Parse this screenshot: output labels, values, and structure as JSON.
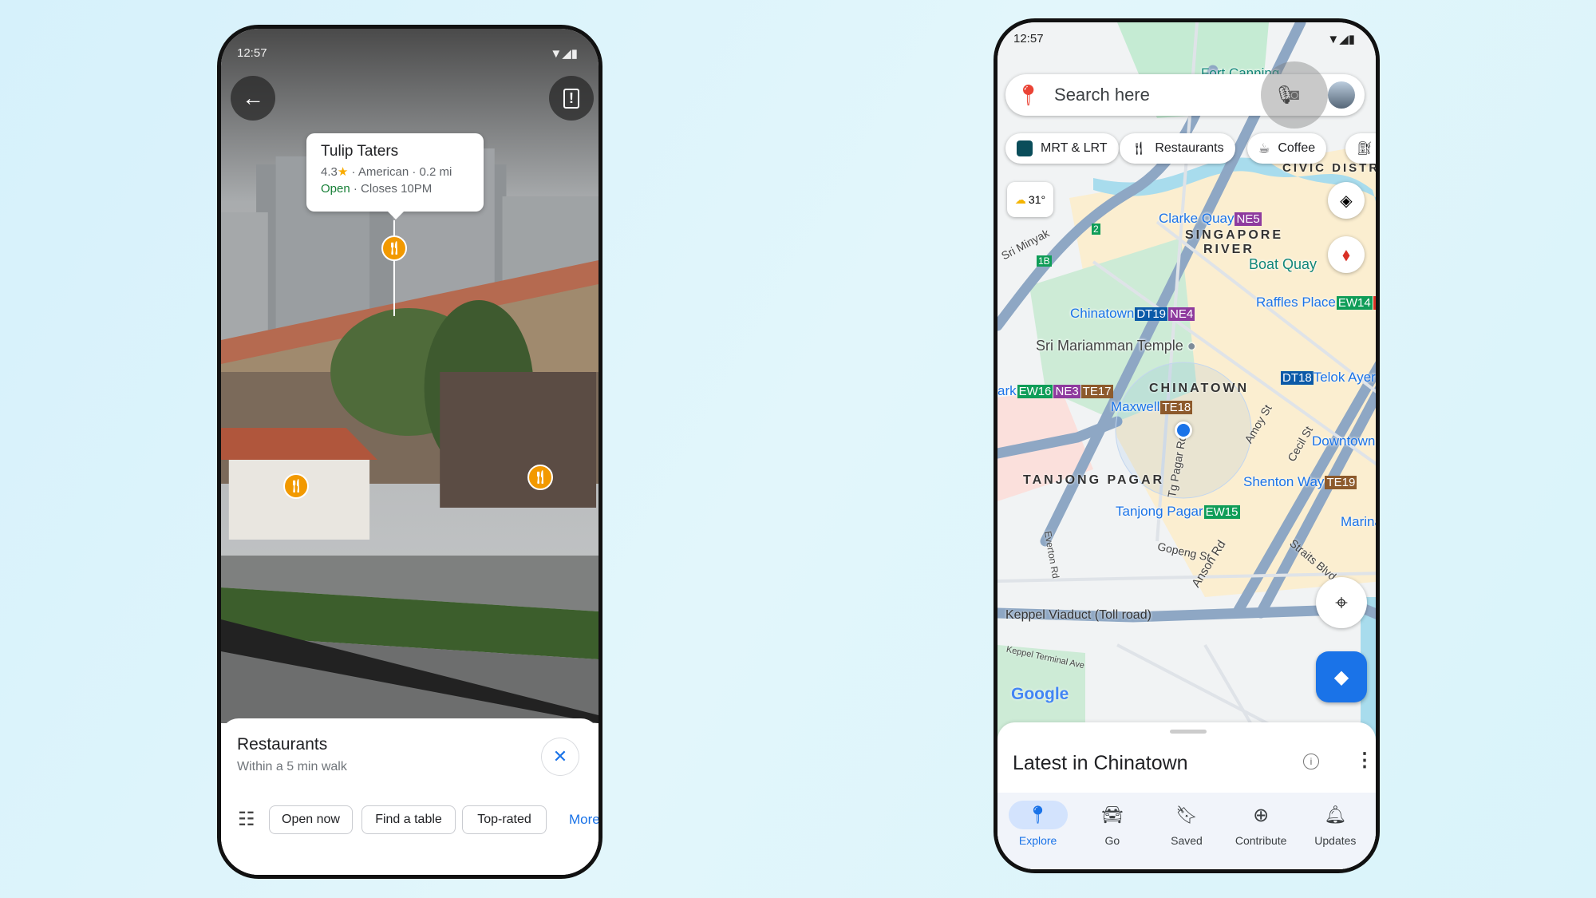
{
  "left_phone": {
    "status_time": "12:57",
    "place_card": {
      "name": "Tulip Taters",
      "rating": "4.3",
      "category": "American",
      "distance": "0.2 mi",
      "open_status": "Open",
      "hours": "Closes 10PM"
    },
    "sheet": {
      "title": "Restaurants",
      "subtitle": "Within a 5 min walk",
      "chips": [
        "Open now",
        "Find a table",
        "Top-rated"
      ],
      "more": "More"
    }
  },
  "right_phone": {
    "status_time": "12:57",
    "search_placeholder": "Search here",
    "chips": [
      "MRT & LRT",
      "Restaurants",
      "Coffee"
    ],
    "weather": "31°",
    "map": {
      "labels": [
        "Clarke Quay",
        "SINGAPORE",
        "RIVER",
        "Boat Quay",
        "Raffles Place",
        "Chinatown",
        "Sri Mariamman Temple",
        "CHINATOWN",
        "Maxwell",
        "ark",
        "Telok Ayer",
        "Downtown",
        "TANJONG PAGAR",
        "Shenton Way",
        "Tanjong Pagar",
        "Marina",
        "Gopeng St",
        "Anson Rd",
        "Keppel Viaduct (Toll road)",
        "Tg Pagar Rd",
        "Everton Rd",
        "Straits Blvd",
        "Amoy St",
        "Cecil St",
        "Keppel Terminal Ave",
        "CIVIC DISTRIC",
        "Sri Minyak",
        "Fort Canning",
        "Google"
      ],
      "badges": [
        "NE5",
        "EW14",
        "N",
        "DT19",
        "NE4",
        "TE18",
        "EW16",
        "NE3",
        "TE17",
        "DT18",
        "TE19",
        "EW15",
        "2",
        "1B"
      ]
    },
    "sheet_title": "Latest in Chinatown",
    "nav": [
      {
        "label": "Explore",
        "active": true
      },
      {
        "label": "Go"
      },
      {
        "label": "Saved"
      },
      {
        "label": "Contribute"
      },
      {
        "label": "Updates"
      }
    ],
    "colors": {
      "accent": "#1a73e8",
      "open": "#188038",
      "pin": "#f29900"
    }
  }
}
